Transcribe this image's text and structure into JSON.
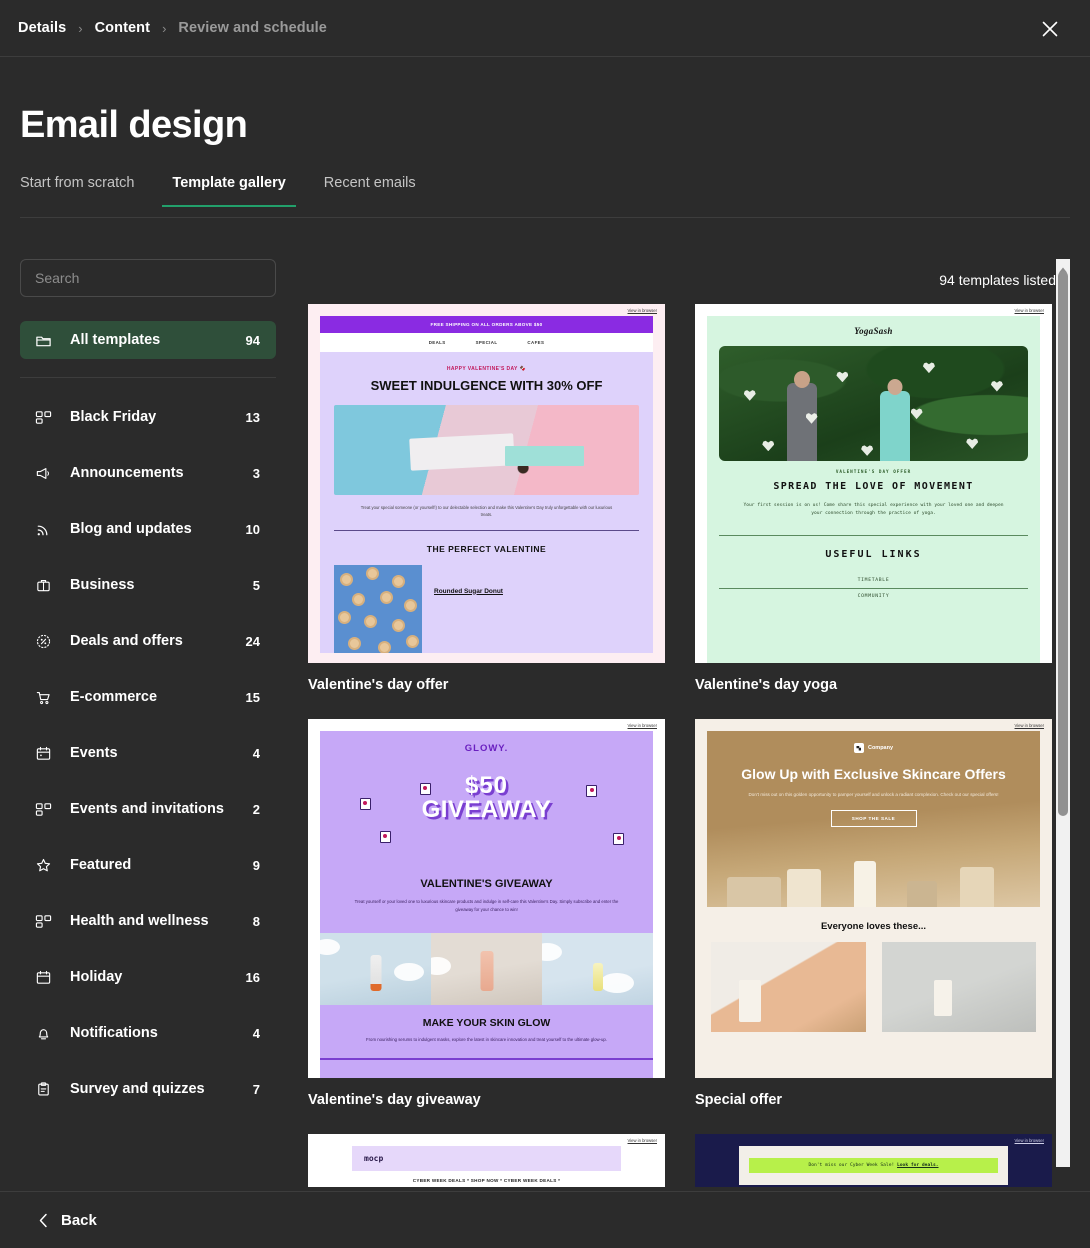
{
  "breadcrumb": {
    "items": [
      {
        "label": "Details",
        "active": true
      },
      {
        "label": "Content",
        "active": true
      },
      {
        "label": "Review and schedule",
        "active": false
      }
    ],
    "separator": "›"
  },
  "header": {
    "title": "Email design",
    "close_label": "Close"
  },
  "tabs": [
    {
      "label": "Start from scratch",
      "active": false
    },
    {
      "label": "Template gallery",
      "active": true
    },
    {
      "label": "Recent emails",
      "active": false
    }
  ],
  "search": {
    "placeholder": "Search",
    "value": ""
  },
  "sidebar": {
    "selected": {
      "label": "All templates",
      "count": "94",
      "icon": "folder-icon"
    },
    "categories": [
      {
        "label": "Black Friday",
        "count": "13",
        "icon": "layout-icon"
      },
      {
        "label": "Announcements",
        "count": "3",
        "icon": "megaphone-icon"
      },
      {
        "label": "Blog and updates",
        "count": "10",
        "icon": "rss-icon"
      },
      {
        "label": "Business",
        "count": "5",
        "icon": "briefcase-icon"
      },
      {
        "label": "Deals and offers",
        "count": "24",
        "icon": "discount-icon"
      },
      {
        "label": "E-commerce",
        "count": "15",
        "icon": "cart-icon"
      },
      {
        "label": "Events",
        "count": "4",
        "icon": "calendar-icon"
      },
      {
        "label": "Events and invitations",
        "count": "2",
        "icon": "layout-icon"
      },
      {
        "label": "Featured",
        "count": "9",
        "icon": "star-icon"
      },
      {
        "label": "Health and wellness",
        "count": "8",
        "icon": "layout-icon"
      },
      {
        "label": "Holiday",
        "count": "16",
        "icon": "calendar-icon"
      },
      {
        "label": "Notifications",
        "count": "4",
        "icon": "bell-icon"
      },
      {
        "label": "Survey and quizzes",
        "count": "7",
        "icon": "clipboard-icon"
      }
    ]
  },
  "main": {
    "count_text": "94 templates listed",
    "accent_color": "#22a06b",
    "selected_bg": "#2f4f3a",
    "templates": [
      {
        "title": "Valentine's day offer",
        "view_in_browser": "View in browser",
        "banner": "FREE SHIPPING ON ALL ORDERS ABOVE $50",
        "nav": [
          "DEALS",
          "SPECIAL",
          "CAFES"
        ],
        "eyebrow": "HAPPY VALENTINE'S DAY 🍫",
        "heading": "SWEET INDULGENCE WITH 30% OFF",
        "blurb": "Treat your special someone (or yourself!) to our delectable selection and make this Valentine's Day truly unforgettable with our luxurious treats.",
        "section_heading": "THE PERFECT VALENTINE",
        "product_name": "Rounded Sugar Donut"
      },
      {
        "title": "Valentine's day yoga",
        "view_in_browser": "View in browser",
        "logo": "YogaSash",
        "eyebrow": "VALENTINE'S DAY OFFER",
        "heading": "SPREAD THE LOVE OF MOVEMENT",
        "blurb": "Your first session is on us! Come share this special experience with your loved one and deepen your connection through the practice of yoga.",
        "section_heading": "USEFUL LINKS",
        "links": [
          "TIMETABLE",
          "COMMUNITY"
        ]
      },
      {
        "title": "Valentine's day giveaway",
        "view_in_browser": "View in browser",
        "logo": "GLOWY.",
        "big_line_1": "$50",
        "big_line_2": "GIVEAWAY",
        "heading": "VALENTINE'S GIVEAWAY",
        "blurb": "Treat yourself or your loved one to luxurious skincare products and indulge in self-care this Valentine's Day. Simply subscribe and enter the giveaway for your chance to win!",
        "section_heading": "MAKE YOUR SKIN GLOW",
        "blurb2": "From nourishing serums to indulgent masks, explore the latest in skincare innovation and treat yourself to the ultimate glow-up."
      },
      {
        "title": "Special offer",
        "view_in_browser": "View in browser",
        "company": "Company",
        "heading": "Glow Up with Exclusive Skincare Offers",
        "blurb": "Don't miss out on this golden opportunity to pamper yourself and unlock a radiant complexion. Check out our special offers!",
        "cta": "SHOP THE SALE",
        "section_heading": "Everyone loves these..."
      },
      {
        "title": "",
        "view_in_browser": "View in browser",
        "logo": "mocp",
        "ticker": "CYBER WEEK DEALS * SHOP NOW * CYBER WEEK DEALS *"
      },
      {
        "title": "",
        "view_in_browser": "View in browser",
        "bar_text": "Don't miss our Cyber Week Sale!",
        "bar_link": "Look for deals."
      }
    ]
  },
  "footer": {
    "back_label": "Back"
  }
}
